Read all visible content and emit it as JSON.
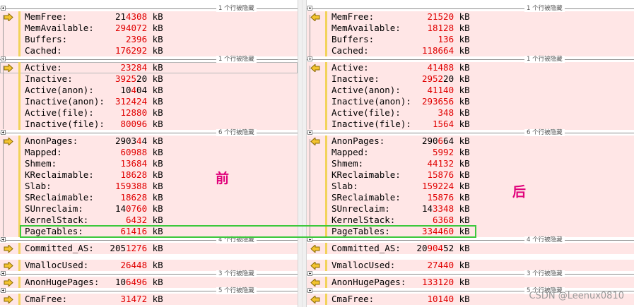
{
  "separators": {
    "l1": "1 个行被隐藏",
    "r1": "1 个行被隐藏",
    "l2": "1 个行被隐藏",
    "r2": "1 个行被隐藏",
    "l3": "6 个行被隐藏",
    "r3": "6 个行被隐藏",
    "l4": "4 个行被隐藏",
    "r4": "4 个行被隐藏",
    "l5": "3 个行被隐藏",
    "r5": "3 个行被隐藏",
    "l6": "5 个行被隐藏",
    "r6": "5 个行被隐藏"
  },
  "left": {
    "memfree": {
      "k": "MemFree:         ",
      "a": "21",
      "b": "4308",
      "u": " kB"
    },
    "memavailable": {
      "k": "MemAvailable:    ",
      "a": "",
      "b": "294072",
      "u": " kB"
    },
    "buffers": {
      "k": "Buffers:         ",
      "a": "  ",
      "b": "2396",
      "u": " kB"
    },
    "cached": {
      "k": "Cached:          ",
      "a": "",
      "b": "176292",
      "u": " kB"
    },
    "active": {
      "k": "Active:          ",
      "a": " ",
      "b": "23284",
      "u": " kB"
    },
    "inactive": {
      "k": "Inactive:        ",
      "a": "",
      "b": "3925",
      "c": "20",
      "u": " kB"
    },
    "active_anon": {
      "k": "Active(anon):    ",
      "a": " 10",
      "b": "4",
      "c": "04",
      "u": " kB"
    },
    "inactive_anon": {
      "k": "Inactive(anon):  ",
      "a": "",
      "b": "312424",
      "u": " kB"
    },
    "active_file": {
      "k": "Active(file):    ",
      "a": " ",
      "b": "12880",
      "u": " kB"
    },
    "inactive_file": {
      "k": "Inactive(file):  ",
      "a": " ",
      "b": "80096",
      "u": " kB"
    },
    "anonpages": {
      "k": "AnonPages:       ",
      "a": "2903",
      "b": "4",
      "c": "4",
      "u": " kB"
    },
    "mapped": {
      "k": "Mapped:          ",
      "a": " ",
      "b": "60988",
      "u": " kB"
    },
    "shmem": {
      "k": "Shmem:           ",
      "a": " ",
      "b": "13684",
      "u": " kB"
    },
    "kreclaimable": {
      "k": "KReclaimable:    ",
      "a": " ",
      "b": "18628",
      "u": " kB"
    },
    "slab": {
      "k": "Slab:            ",
      "a": "",
      "b": "159388",
      "u": " kB"
    },
    "sreclaimable": {
      "k": "SReclaimable:    ",
      "a": " ",
      "b": "18628",
      "u": " kB"
    },
    "sunreclaim": {
      "k": "SUnreclaim:      ",
      "a": "14",
      "b": "0760",
      "u": " kB"
    },
    "kernelstack": {
      "k": "KernelStack:     ",
      "a": "  ",
      "b": "6432",
      "u": " kB"
    },
    "pagetables": {
      "k": "PageTables:      ",
      "a": " ",
      "b": "61416",
      "u": " kB"
    },
    "committed_as": {
      "k": "Committed_AS:   ",
      "a": "205",
      "b": "1276",
      "u": " kB"
    },
    "vmallocused": {
      "k": "VmallocUsed:     ",
      "a": " ",
      "b": "26448",
      "u": " kB"
    },
    "anonhugepages": {
      "k": "AnonHugePages:   ",
      "a": "10",
      "b": "6496",
      "u": " kB"
    },
    "cmafree": {
      "k": "CmaFree:         ",
      "a": " ",
      "b": "31472",
      "u": " kB"
    }
  },
  "right": {
    "memfree": {
      "k": "MemFree:         ",
      "a": " ",
      "b": "21520",
      "u": " kB"
    },
    "memavailable": {
      "k": "MemAvailable:    ",
      "a": " ",
      "b": "18128",
      "u": " kB"
    },
    "buffers": {
      "k": "Buffers:         ",
      "a": "   ",
      "b": "136",
      "u": " kB"
    },
    "cached": {
      "k": "Cached:          ",
      "a": "",
      "b": "118664",
      "u": " kB"
    },
    "active": {
      "k": "Active:          ",
      "a": " ",
      "b": "41488",
      "u": " kB"
    },
    "inactive": {
      "k": "Inactive:        ",
      "a": "",
      "b": "2952",
      "c": "20",
      "u": " kB"
    },
    "active_anon": {
      "k": "Active(anon):    ",
      "a": " ",
      "b": "41140",
      "u": " kB"
    },
    "inactive_anon": {
      "k": "Inactive(anon):  ",
      "a": "",
      "b": "293656",
      "u": " kB"
    },
    "active_file": {
      "k": "Active(file):    ",
      "a": "   ",
      "b": "348",
      "u": " kB"
    },
    "inactive_file": {
      "k": "Inactive(file):  ",
      "a": "  ",
      "b": "1564",
      "u": " kB"
    },
    "anonpages": {
      "k": "AnonPages:       ",
      "a": "290",
      "b": "6",
      "c": "64",
      "u": " kB"
    },
    "mapped": {
      "k": "Mapped:          ",
      "a": "  ",
      "b": "5992",
      "u": " kB"
    },
    "shmem": {
      "k": "Shmem:           ",
      "a": " ",
      "b": "44132",
      "u": " kB"
    },
    "kreclaimable": {
      "k": "KReclaimable:    ",
      "a": " ",
      "b": "15876",
      "u": " kB"
    },
    "slab": {
      "k": "Slab:            ",
      "a": "",
      "b": "159224",
      "u": " kB"
    },
    "sreclaimable": {
      "k": "SReclaimable:    ",
      "a": " ",
      "b": "15876",
      "u": " kB"
    },
    "sunreclaim": {
      "k": "SUnreclaim:      ",
      "a": "14",
      "b": "3348",
      "u": " kB"
    },
    "kernelstack": {
      "k": "KernelStack:     ",
      "a": "  ",
      "b": "6368",
      "u": " kB"
    },
    "pagetables": {
      "k": "PageTables:      ",
      "a": "",
      "b": "334460",
      "u": " kB"
    },
    "committed_as": {
      "k": "Committed_AS:   ",
      "a": "20",
      "b": "904",
      "c": "52",
      "u": " kB"
    },
    "vmallocused": {
      "k": "VmallocUsed:     ",
      "a": " ",
      "b": "27440",
      "u": " kB"
    },
    "anonhugepages": {
      "k": "AnonHugePages:   ",
      "a": "",
      "b": "133120",
      "u": " kB"
    },
    "cmafree": {
      "k": "CmaFree:         ",
      "a": " ",
      "b": "10140",
      "u": " kB"
    }
  },
  "annotations": {
    "before": "前",
    "after": "后"
  },
  "watermark": "CSDN @Leenux0810",
  "colors": {
    "diff_bg": "#ffe6e6",
    "changed_text": "#e00000",
    "gutter_bar": "#f2d35b",
    "highlight_box": "#3cc83c",
    "annotation": "#e0007a"
  }
}
